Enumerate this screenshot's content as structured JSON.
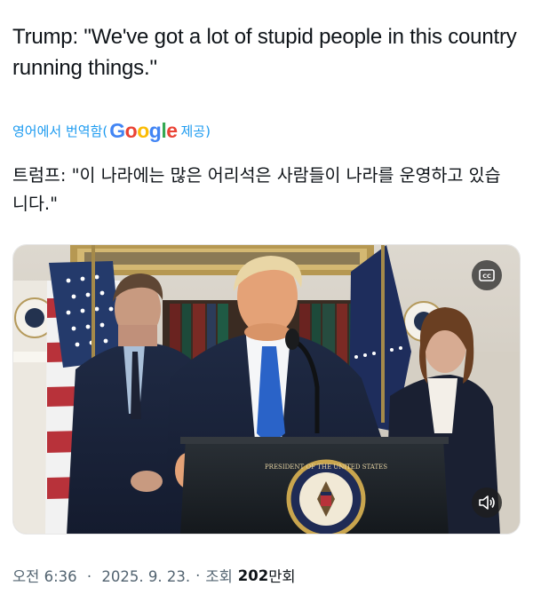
{
  "tweet": {
    "text": "Trump: \"We've got a lot of stupid people in this country running things.\"",
    "translate": {
      "prefix": "영어에서 번역함(",
      "brand": "Google",
      "suffix": " 제공)"
    },
    "translated_text": "트럼프: \"이 나라에는 많은 어리석은 사람들이 나라를 운영하고 있습니다.\""
  },
  "media": {
    "cc_icon": "closed-captions-icon",
    "mute_icon": "speaker-icon",
    "seal_text": "PRESIDENT OF THE UNITED STATES"
  },
  "meta": {
    "time": "오전 6:36",
    "separator": "·",
    "date": "2025. 9. 23.",
    "views_label": "조회",
    "views_count": "202",
    "views_unit": "만회"
  },
  "colors": {
    "link": "#1d9bf0",
    "text": "#0f1419",
    "muted": "#536471"
  }
}
